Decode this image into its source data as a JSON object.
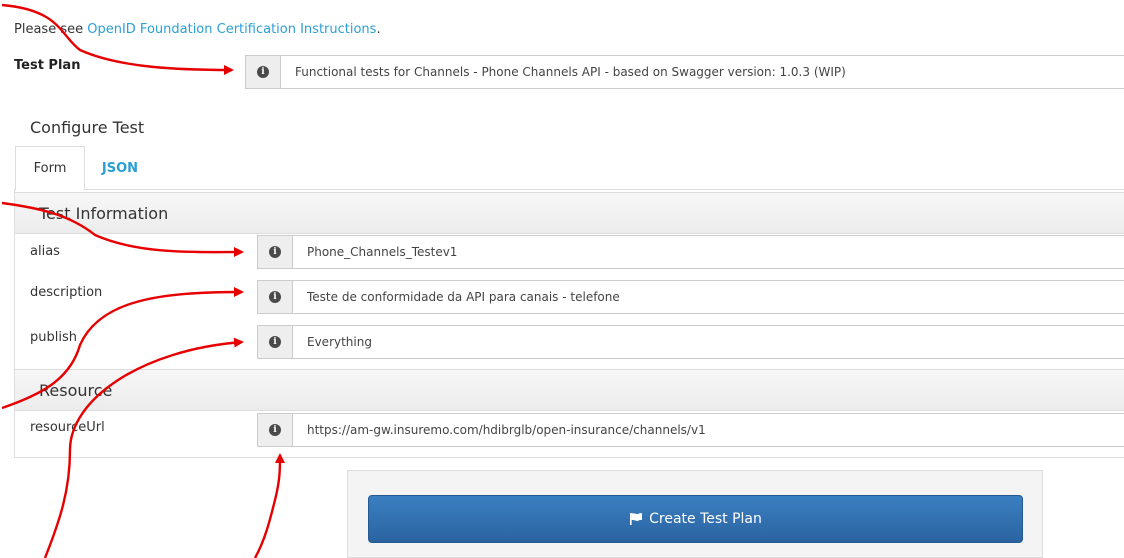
{
  "notice": {
    "prefix": "Please see ",
    "link": "OpenID Foundation Certification Instructions",
    "suffix": "."
  },
  "test_plan": {
    "label": "Test Plan",
    "value": "Functional tests for Channels - Phone Channels API - based on Swagger version: 1.0.3 (WIP)"
  },
  "configure": {
    "title": "Configure Test",
    "tabs": [
      {
        "label": "Form",
        "active": true
      },
      {
        "label": "JSON",
        "active": false
      }
    ]
  },
  "sections": {
    "test_information": "Test Information",
    "resource": "Resource"
  },
  "fields": {
    "alias": {
      "label": "alias",
      "value": "Phone_Channels_Testev1"
    },
    "description": {
      "label": "description",
      "value": "Teste de conformidade da API para canais - telefone"
    },
    "publish": {
      "label": "publish",
      "value": "Everything"
    },
    "resourceUrl": {
      "label": "resourceUrl",
      "value": "https://am-gw.insuremo.com/hdibrglb/open-insurance/channels/v1"
    }
  },
  "create_button": {
    "label": "Create Test Plan",
    "icon": "flag-icon"
  },
  "colors": {
    "link": "#2a9fd6",
    "button": "#2b63a0",
    "annotation": "#e60000"
  }
}
